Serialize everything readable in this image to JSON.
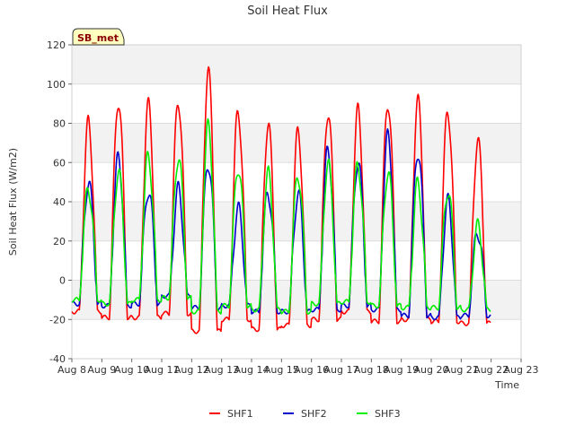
{
  "chart_data": {
    "type": "line",
    "title": "Soil Heat Flux",
    "xlabel": "Time",
    "ylabel": "Soil Heat Flux (W/m2)",
    "site_label": "SB_met",
    "xlim": [
      8,
      23
    ],
    "ylim": [
      -40,
      120
    ],
    "yticks": [
      -40,
      -20,
      0,
      20,
      40,
      60,
      80,
      100,
      120
    ],
    "xticks": [
      {
        "x": 8,
        "label": "Aug 8"
      },
      {
        "x": 9,
        "label": "Aug 9"
      },
      {
        "x": 10,
        "label": "Aug 10"
      },
      {
        "x": 11,
        "label": "Aug 11"
      },
      {
        "x": 12,
        "label": "Aug 12"
      },
      {
        "x": 13,
        "label": "Aug 13"
      },
      {
        "x": 14,
        "label": "Aug 14"
      },
      {
        "x": 15,
        "label": "Aug 15"
      },
      {
        "x": 16,
        "label": "Aug 16"
      },
      {
        "x": 17,
        "label": "Aug 17"
      },
      {
        "x": 18,
        "label": "Aug 18"
      },
      {
        "x": 19,
        "label": "Aug 19"
      },
      {
        "x": 20,
        "label": "Aug 20"
      },
      {
        "x": 21,
        "label": "Aug 21"
      },
      {
        "x": 22,
        "label": "Aug 22"
      },
      {
        "x": 23,
        "label": "Aug 23"
      }
    ],
    "grid": true,
    "legend_position": "bottom-center",
    "days": [
      8,
      9,
      10,
      11,
      12,
      13,
      14,
      15,
      16,
      17,
      18,
      19,
      20,
      21
    ],
    "series": [
      {
        "name": "SHF1",
        "color": "#ff0000",
        "peaks": [
          80,
          92,
          89,
          92,
          106,
          86,
          80,
          75,
          86,
          86,
          91,
          91,
          87,
          71
        ],
        "troughs": [
          -16,
          -19,
          -19,
          -17,
          -26,
          -20,
          -25,
          -23,
          -20,
          -16,
          -21,
          -20,
          -21,
          -22
        ]
      },
      {
        "name": "SHF2",
        "color": "#0000cc",
        "peaks": [
          50,
          62,
          46,
          46,
          60,
          36,
          45,
          44,
          66,
          61,
          73,
          66,
          40,
          25
        ],
        "troughs": [
          -12,
          -13,
          -12,
          -8,
          -14,
          -13,
          -16,
          -16,
          -15,
          -13,
          -15,
          -18,
          -19,
          -18
        ]
      },
      {
        "name": "SHF3",
        "color": "#00ee00",
        "peaks": [
          47,
          55,
          63,
          63,
          78,
          58,
          54,
          54,
          59,
          59,
          55,
          49,
          46,
          27
        ],
        "troughs": [
          -10,
          -12,
          -10,
          -9,
          -16,
          -13,
          -15,
          -16,
          -12,
          -11,
          -13,
          -14,
          -14,
          -15
        ]
      }
    ]
  }
}
